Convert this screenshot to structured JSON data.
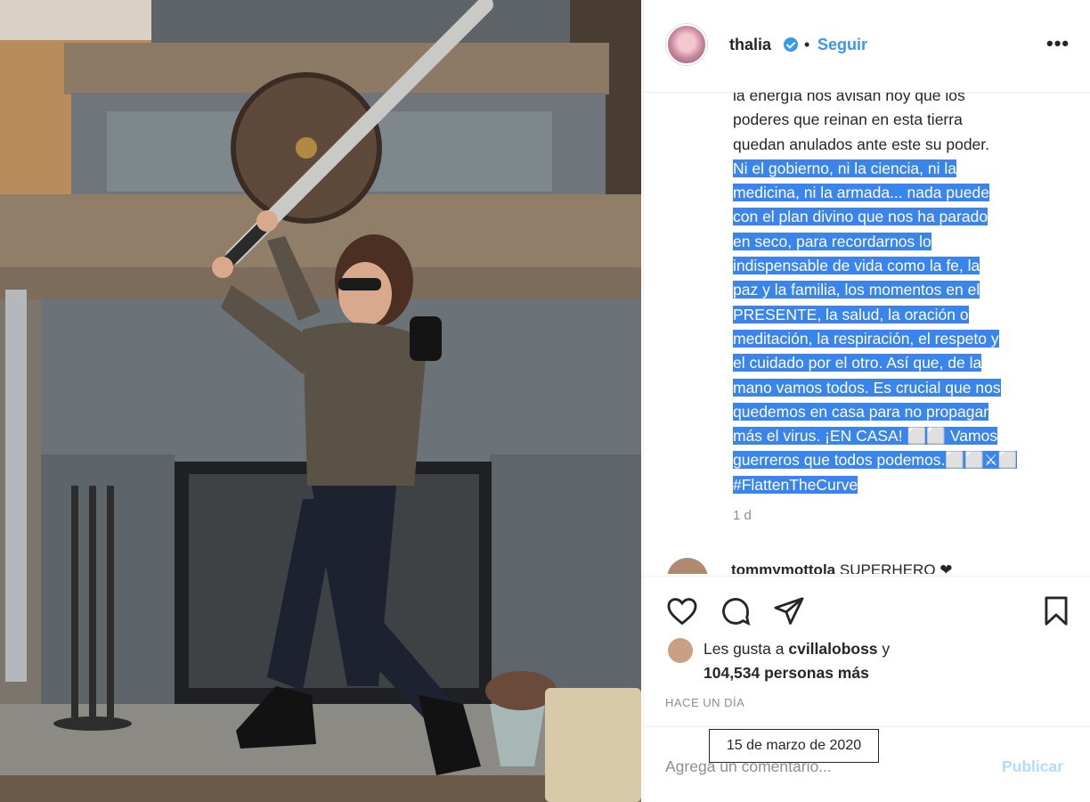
{
  "header": {
    "username": "thalia",
    "separator": "•",
    "follow_label": "Seguir",
    "more_label": "•••"
  },
  "caption": {
    "lines_plain": [
      "la energía nos avisan hoy que los",
      "poderes que reinan en esta tierra",
      "quedan anulados ante este su poder."
    ],
    "lines_selected": [
      "Ni el gobierno, ni la ciencia, ni la",
      "medicina, ni la armada... nada puede",
      "con el plan divino que nos ha parado",
      "en seco, para recordarnos lo",
      "indispensable de vida como la fe, la",
      "paz y la familia, los momentos en el",
      "PRESENTE, la salud, la oración o",
      "meditación, la respiración, el respeto y",
      "el cuidado por el otro. Así que, de la",
      "mano vamos todos. Es crucial que nos",
      "quedemos en casa para no propagar",
      "más el virus. ¡EN CASA! ⬜⬜ Vamos",
      "guerreros que todos podemos.⬜⬜⚔⬜",
      "#FlattenTheCurve"
    ],
    "time_ago": "1 d"
  },
  "comment_peek": {
    "username": "tommymottola",
    "text": "SUPERHERO ❤"
  },
  "likes": {
    "prefix": "Les gusta a",
    "user": "cvillaloboss",
    "connector": "y",
    "count_text": "104,534 personas más"
  },
  "post_time": "HACE UN DÍA",
  "tooltip": "15 de marzo de 2020",
  "comment_box": {
    "placeholder": "Agrega un comentario...",
    "publish_label": "Publicar"
  },
  "colors": {
    "accent": "#3897f0",
    "selection": "#3a84ee",
    "muted": "#8e8e8e"
  },
  "icons": [
    "heart-icon",
    "comment-icon",
    "share-icon",
    "bookmark-icon",
    "verified-badge-icon",
    "more-options-icon"
  ]
}
